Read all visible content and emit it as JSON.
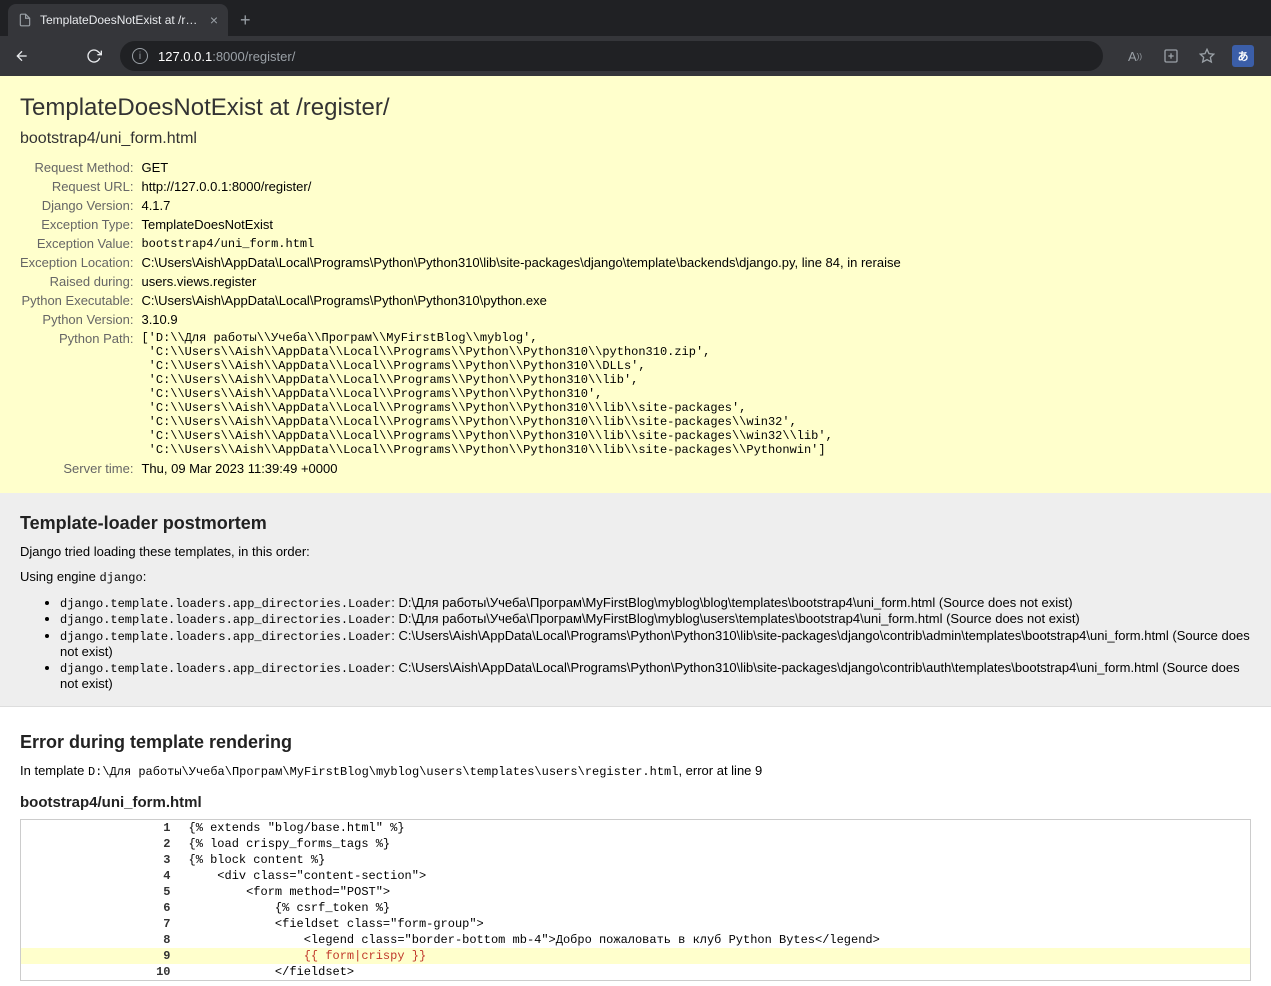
{
  "browser": {
    "tab_title": "TemplateDoesNotExist at /registe",
    "url_host": "127.0.0.1",
    "url_port": ":8000",
    "url_path": "/register/"
  },
  "summary": {
    "title": "TemplateDoesNotExist at /register/",
    "exception_value": "bootstrap4/uni_form.html",
    "rows": {
      "request_method": {
        "label": "Request Method:",
        "value": "GET"
      },
      "request_url": {
        "label": "Request URL:",
        "value": "http://127.0.0.1:8000/register/"
      },
      "django_version": {
        "label": "Django Version:",
        "value": "4.1.7"
      },
      "exception_type": {
        "label": "Exception Type:",
        "value": "TemplateDoesNotExist"
      },
      "exception_value_label": "Exception Value:",
      "exception_value_code": "bootstrap4/uni_form.html",
      "exception_location": {
        "label": "Exception Location:",
        "value": "C:\\Users\\Aish\\AppData\\Local\\Programs\\Python\\Python310\\lib\\site-packages\\django\\template\\backends\\django.py, line 84, in reraise"
      },
      "raised_during": {
        "label": "Raised during:",
        "value": "users.views.register"
      },
      "python_executable": {
        "label": "Python Executable:",
        "value": "C:\\Users\\Aish\\AppData\\Local\\Programs\\Python\\Python310\\python.exe"
      },
      "python_version": {
        "label": "Python Version:",
        "value": "3.10.9"
      },
      "python_path_label": "Python Path:",
      "python_path": "['D:\\\\Для работы\\\\Учеба\\\\Програм\\\\MyFirstBlog\\\\myblog',\n 'C:\\\\Users\\\\Aish\\\\AppData\\\\Local\\\\Programs\\\\Python\\\\Python310\\\\python310.zip',\n 'C:\\\\Users\\\\Aish\\\\AppData\\\\Local\\\\Programs\\\\Python\\\\Python310\\\\DLLs',\n 'C:\\\\Users\\\\Aish\\\\AppData\\\\Local\\\\Programs\\\\Python\\\\Python310\\\\lib',\n 'C:\\\\Users\\\\Aish\\\\AppData\\\\Local\\\\Programs\\\\Python\\\\Python310',\n 'C:\\\\Users\\\\Aish\\\\AppData\\\\Local\\\\Programs\\\\Python\\\\Python310\\\\lib\\\\site-packages',\n 'C:\\\\Users\\\\Aish\\\\AppData\\\\Local\\\\Programs\\\\Python\\\\Python310\\\\lib\\\\site-packages\\\\win32',\n 'C:\\\\Users\\\\Aish\\\\AppData\\\\Local\\\\Programs\\\\Python\\\\Python310\\\\lib\\\\site-packages\\\\win32\\\\lib',\n 'C:\\\\Users\\\\Aish\\\\AppData\\\\Local\\\\Programs\\\\Python\\\\Python310\\\\lib\\\\site-packages\\\\Pythonwin']",
      "server_time": {
        "label": "Server time:",
        "value": "Thu, 09 Mar 2023 11:39:49 +0000"
      }
    }
  },
  "postmortem": {
    "heading": "Template-loader postmortem",
    "intro": "Django tried loading these templates, in this order:",
    "engine_prefix": "Using engine ",
    "engine_name": "django",
    "engine_suffix": ":",
    "loader": "django.template.loaders.app_directories.Loader",
    "items": [
      "D:\\Для работы\\Учеба\\Програм\\MyFirstBlog\\myblog\\blog\\templates\\bootstrap4\\uni_form.html (Source does not exist)",
      "D:\\Для работы\\Учеба\\Програм\\MyFirstBlog\\myblog\\users\\templates\\bootstrap4\\uni_form.html (Source does not exist)",
      "C:\\Users\\Aish\\AppData\\Local\\Programs\\Python\\Python310\\lib\\site-packages\\django\\contrib\\admin\\templates\\bootstrap4\\uni_form.html (Source does not exist)",
      "C:\\Users\\Aish\\AppData\\Local\\Programs\\Python\\Python310\\lib\\site-packages\\django\\contrib\\auth\\templates\\bootstrap4\\uni_form.html (Source does not exist)"
    ]
  },
  "template_error": {
    "heading": "Error during template rendering",
    "in_template_prefix": "In template ",
    "in_template_path": "D:\\Для работы\\Учеба\\Програм\\MyFirstBlog\\myblog\\users\\templates\\users\\register.html",
    "in_template_suffix": ", error at line 9",
    "sub_heading": "bootstrap4/uni_form.html",
    "source": [
      {
        "n": "1",
        "code": "{% extends \"blog/base.html\" %}"
      },
      {
        "n": "2",
        "code": "{% load crispy_forms_tags %}"
      },
      {
        "n": "3",
        "code": "{% block content %}"
      },
      {
        "n": "4",
        "code": "    <div class=\"content-section\">"
      },
      {
        "n": "5",
        "code": "        <form method=\"POST\">"
      },
      {
        "n": "6",
        "code": "            {% csrf_token %}"
      },
      {
        "n": "7",
        "code": "            <fieldset class=\"form-group\">"
      },
      {
        "n": "8",
        "code": "                <legend class=\"border-bottom mb-4\">Добро пожаловать в клуб Python Bytes</legend>"
      },
      {
        "n": "9",
        "code": "                {{ form|crispy }}",
        "error": true
      },
      {
        "n": "10",
        "code": "            </fieldset>"
      }
    ]
  }
}
